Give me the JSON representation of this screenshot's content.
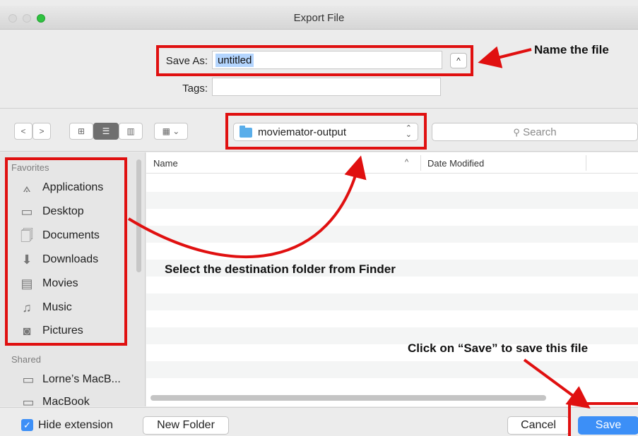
{
  "window": {
    "title": "Export File"
  },
  "save_as": {
    "label": "Save As:",
    "value": "untitled",
    "expand_glyph": "^"
  },
  "tags": {
    "label": "Tags:",
    "value": ""
  },
  "toolbar": {
    "back_glyph": "<",
    "forward_glyph": ">",
    "icon_view_glyph": "⊞",
    "list_view_glyph": "☰",
    "column_view_glyph": "▥",
    "arrange_glyph": "▦ ⌄",
    "location": "moviemator-output",
    "location_arrows": "⌃⌄",
    "search_placeholder": "Search",
    "search_glyph": "🔍"
  },
  "sidebar": {
    "favorites_header": "Favorites",
    "favorites": [
      {
        "label": "Applications",
        "icon": "applications-icon"
      },
      {
        "label": "Desktop",
        "icon": "desktop-icon"
      },
      {
        "label": "Documents",
        "icon": "documents-icon"
      },
      {
        "label": "Downloads",
        "icon": "downloads-icon"
      },
      {
        "label": "Movies",
        "icon": "movies-icon"
      },
      {
        "label": "Music",
        "icon": "music-icon"
      },
      {
        "label": "Pictures",
        "icon": "pictures-icon"
      }
    ],
    "shared_header": "Shared",
    "shared": [
      {
        "label": "Lorne’s MacB...",
        "icon": "laptop-icon"
      },
      {
        "label": "MacBook",
        "icon": "laptop-icon"
      }
    ]
  },
  "file_list": {
    "columns": {
      "name": "Name",
      "sort_glyph": "^",
      "date": "Date Modified"
    }
  },
  "bottom": {
    "hide_extension_label": "Hide extension",
    "hide_extension_checked": true,
    "new_folder_label": "New Folder",
    "cancel_label": "Cancel",
    "save_label": "Save"
  },
  "annotations": {
    "name_file": "Name the file",
    "select_folder": "Select the destination folder from Finder",
    "click_save": "Click on “Save” to save this file"
  },
  "colors": {
    "accent": "#3c8ff7",
    "annotation_red": "#e01010"
  }
}
